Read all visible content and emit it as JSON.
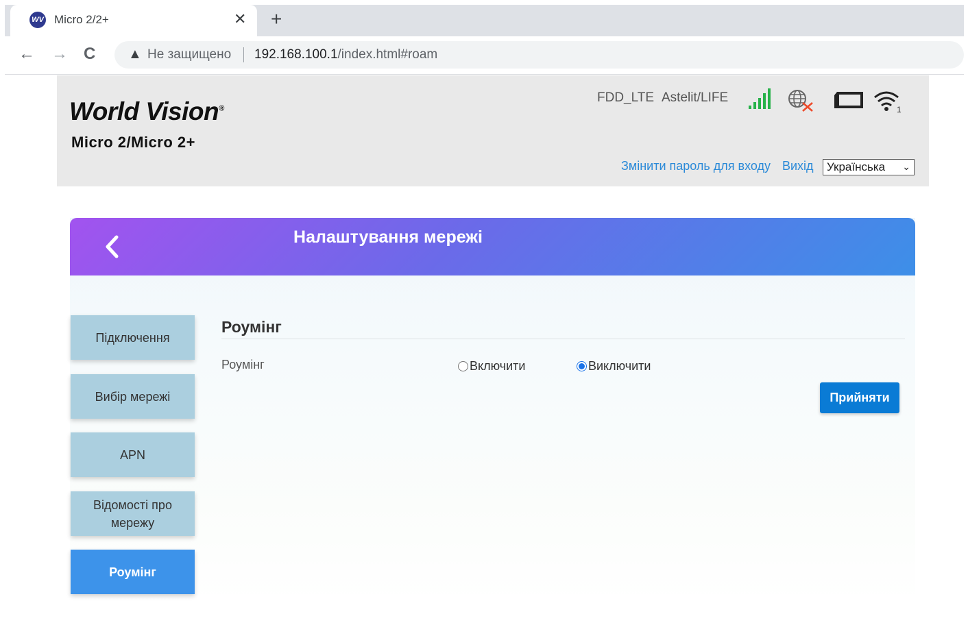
{
  "browser": {
    "tab_title": "Micro 2/2+",
    "favicon_text": "WV",
    "close_glyph": "✕",
    "new_tab_glyph": "+",
    "back_glyph": "←",
    "forward_glyph": "→",
    "reload_glyph": "C",
    "warning_glyph": "▲",
    "security_label": "Не защищено",
    "url_host": "192.168.100.1",
    "url_path": "/index.html#roam"
  },
  "header": {
    "logo_main": "World Vision",
    "logo_reg": "®",
    "logo_sub": "Micro 2/Micro 2+",
    "network_type": "FDD_LTE",
    "operator": "Astelit/LIFE",
    "icons": [
      "signal-icon",
      "globe-disconnected-icon",
      "battery-icon",
      "wifi-icon"
    ],
    "wifi_clients": "1",
    "change_password_link": "Змінити пароль для входу",
    "logout_link": "Вихід",
    "language_selected": "Українська"
  },
  "card": {
    "title": "Налаштування мережі",
    "sidebar": [
      {
        "label": "Підключення",
        "active": false
      },
      {
        "label": "Вибір мережі",
        "active": false
      },
      {
        "label": "APN",
        "active": false
      },
      {
        "label": "Відомості про мережу",
        "active": false
      },
      {
        "label": "Роумінг",
        "active": true
      }
    ],
    "section_title": "Роумінг",
    "field_label": "Роумінг",
    "option_on": "Включити",
    "option_off": "Виключити",
    "selected_option": "Виключити",
    "apply_button": "Прийняти"
  },
  "colors": {
    "header_gradient_start": "#a253ef",
    "header_gradient_end": "#3d8fe8",
    "sidebar_item": "#abcfdf",
    "sidebar_active": "#3d93ea",
    "apply_button": "#0a7bd5",
    "link": "#2b8ad8",
    "signal": "#27b24a"
  }
}
